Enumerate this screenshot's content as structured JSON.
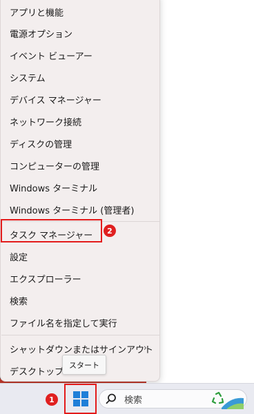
{
  "menu": {
    "items": [
      "アプリと機能",
      "電源オプション",
      "イベント ビューアー",
      "システム",
      "デバイス マネージャー",
      "ネットワーク接続",
      "ディスクの管理",
      "コンピューターの管理",
      "Windows ターミナル",
      "Windows ターミナル (管理者)",
      "タスク マネージャー",
      "設定",
      "エクスプローラー",
      "検索",
      "ファイル名を指定して実行",
      "シャットダウンまたはサインアウト",
      "デスクトップ"
    ],
    "submenu_arrow": "›"
  },
  "tooltip": {
    "text": "スタート"
  },
  "badges": {
    "start": "1",
    "task_manager": "2"
  },
  "taskbar": {
    "search_placeholder": "検索",
    "start_icon": "windows-logo-icon",
    "search_icon": "search-icon",
    "widget_icon": "recycle-bin-icon"
  },
  "colors": {
    "highlight": "#e31b1b",
    "badge": "#e02020",
    "windows_blue": "#1f7fd8"
  }
}
